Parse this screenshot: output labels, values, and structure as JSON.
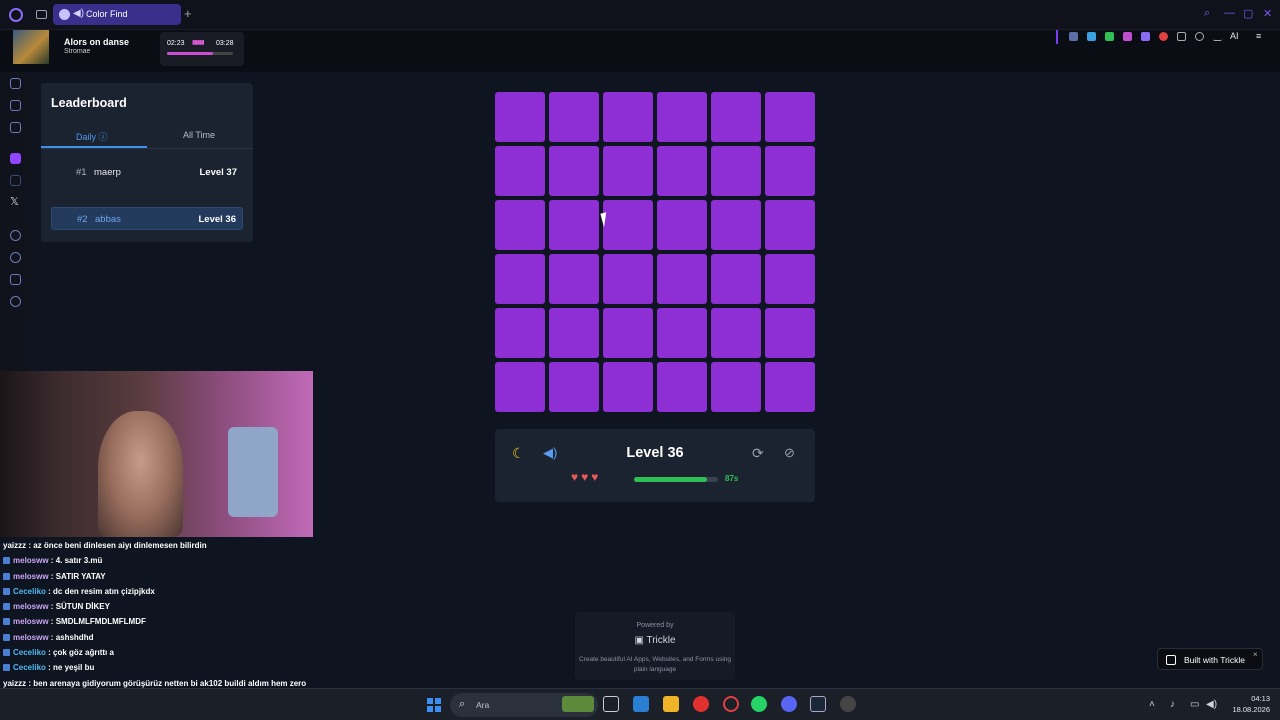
{
  "browser": {
    "tab_title": "Color Find",
    "new_tab": "+",
    "ai_label": "AI"
  },
  "media": {
    "song": "Alors on danse",
    "artist": "Stromae",
    "elapsed": "02:23",
    "total": "03:28",
    "progress": 0.69
  },
  "leaderboard": {
    "title": "Leaderboard",
    "tabs": [
      "Daily ⓘ",
      "All Time"
    ],
    "rows": [
      {
        "rank": "#1",
        "name": "maerp",
        "level": "Level 37"
      },
      {
        "rank": "#2",
        "name": "abbas",
        "level": "Level 36"
      }
    ]
  },
  "game": {
    "grid_color": "#8e2fd6",
    "rows": 6,
    "cols": 6,
    "level": "Level 36",
    "hearts": "♥♥♥",
    "timer": "87s",
    "time_progress": 0.87
  },
  "chat": [
    {
      "user": "yaizzz",
      "text": " : az önce beni dinlesen aiyı dinlemesen bilirdin",
      "badge": false,
      "cls": "u-yai"
    },
    {
      "user": "melosww",
      "text": " : 4. satır 3.mü",
      "badge": true,
      "cls": "u-mel"
    },
    {
      "user": "melosww",
      "text": " : SATIR YATAY",
      "badge": true,
      "cls": "u-mel"
    },
    {
      "user": "Ceceliko",
      "text": " : dc den resim atın çizipjkdx",
      "badge": true,
      "cls": "u-cec"
    },
    {
      "user": "melosww",
      "text": " : SÜTUN DİKEY",
      "badge": true,
      "cls": "u-mel"
    },
    {
      "user": "melosww",
      "text": " : SMDLMLFMDLMFLMDF",
      "badge": true,
      "cls": "u-mel"
    },
    {
      "user": "melosww",
      "text": " : ashshdhd",
      "badge": true,
      "cls": "u-mel"
    },
    {
      "user": "Ceceliko",
      "text": " : çok göz ağrıttı a",
      "badge": true,
      "cls": "u-cec"
    },
    {
      "user": "Ceceliko",
      "text": " : ne yeşil bu",
      "badge": true,
      "cls": "u-cec"
    },
    {
      "user": "yaizzz",
      "text": " : ben arenaya gidiyorum görüşürüz netten bi ak102 buildi aldım hem zero",
      "badge": false,
      "cls": "u-yai"
    }
  ],
  "trickle": {
    "powered": "Powered by",
    "brand": "Trickle",
    "tagline": "Create beautiful AI Apps, Websites, and Forms using plain language",
    "built_with": "Built with Trickle",
    "close": "×"
  },
  "taskbar": {
    "search_placeholder": "Ara",
    "time": "04:13",
    "date": "18.08.2026"
  }
}
